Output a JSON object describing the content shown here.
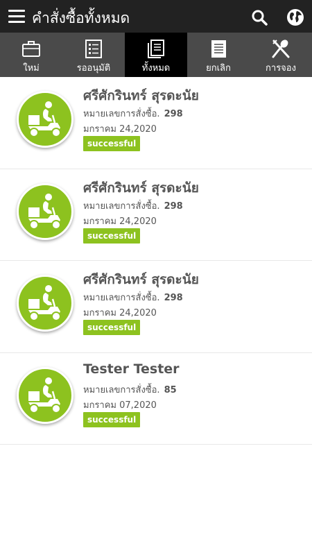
{
  "header": {
    "title": "คำสั่งซื้อทั้งหมด",
    "menu_icon": "hamburger-menu-icon",
    "search_icon": "search-icon",
    "globe_icon": "globe-icon"
  },
  "tabs": [
    {
      "label": "ใหม่",
      "icon": "briefcase-icon",
      "active": false
    },
    {
      "label": "รออนุมัติ",
      "icon": "checklist-icon",
      "active": false
    },
    {
      "label": "ทั้งหมด",
      "icon": "documents-icon",
      "active": true
    },
    {
      "label": "ยกเลิก",
      "icon": "document-icon",
      "active": false
    },
    {
      "label": "การจอง",
      "icon": "utensils-icon",
      "active": false
    }
  ],
  "orders": [
    {
      "customer": "ศรีศักรินทร์ สุรดะนัย",
      "order_label": "หมายเลขการสั่งซื้อ.",
      "order_no": "298",
      "date": "มกราคม 24,2020",
      "status": "successful"
    },
    {
      "customer": "ศรีศักรินทร์ สุรดะนัย",
      "order_label": "หมายเลขการสั่งซื้อ.",
      "order_no": "298",
      "date": "มกราคม 24,2020",
      "status": "successful"
    },
    {
      "customer": "ศรีศักรินทร์ สุรดะนัย",
      "order_label": "หมายเลขการสั่งซื้อ.",
      "order_no": "298",
      "date": "มกราคม 24,2020",
      "status": "successful"
    },
    {
      "customer": "Tester Tester",
      "order_label": "หมายเลขการสั่งซื้อ.",
      "order_no": "85",
      "date": "มกราคม 07,2020",
      "status": "successful"
    }
  ],
  "colors": {
    "header_bg": "#222222",
    "tabbar_bg": "#4a4a4a",
    "active_tab_bg": "#000000",
    "accent_green": "#8dc21f"
  }
}
